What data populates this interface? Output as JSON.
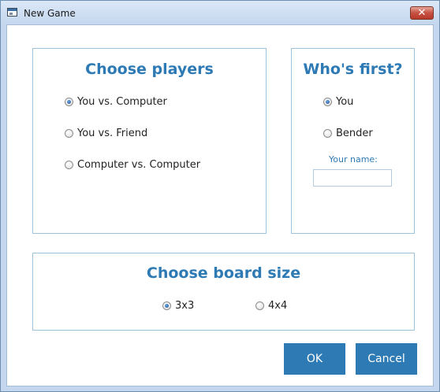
{
  "window": {
    "title": "New Game",
    "close_symbol": "✕"
  },
  "players_group": {
    "title": "Choose players",
    "options": [
      {
        "label": "You vs. Computer",
        "selected": true
      },
      {
        "label": "You vs. Friend",
        "selected": false
      },
      {
        "label": "Computer vs. Computer",
        "selected": false
      }
    ]
  },
  "first_group": {
    "title": "Who's first?",
    "options": [
      {
        "label": "You",
        "selected": true
      },
      {
        "label": "Bender",
        "selected": false
      }
    ],
    "name_label": "Your name:",
    "name_value": ""
  },
  "board_group": {
    "title": "Choose board size",
    "options": [
      {
        "label": "3x3",
        "selected": true
      },
      {
        "label": "4x4",
        "selected": false
      }
    ]
  },
  "buttons": {
    "ok": "OK",
    "cancel": "Cancel"
  },
  "colors": {
    "accent": "#2e7ab4",
    "group_border": "#9cc3d9",
    "window_frame": "#c4d7ee",
    "close_button": "#c75141"
  }
}
